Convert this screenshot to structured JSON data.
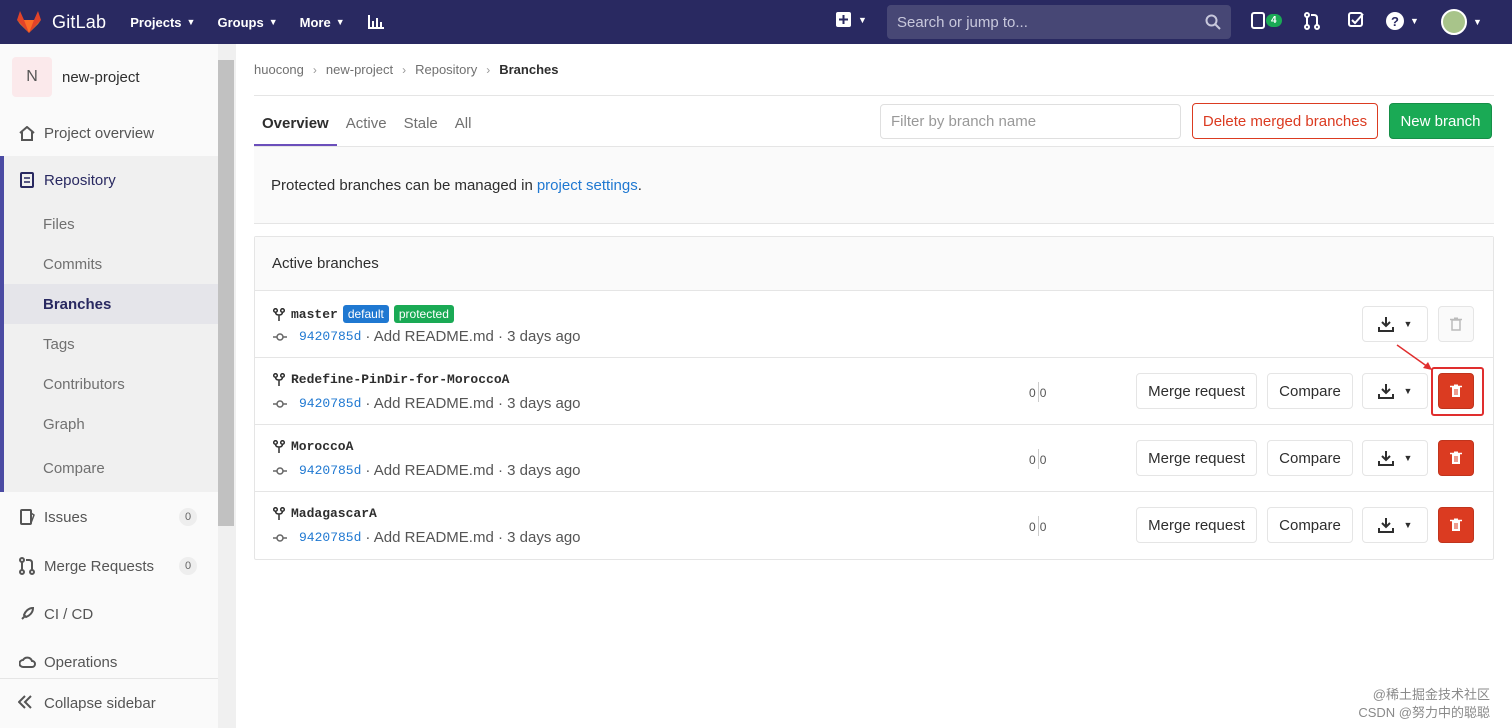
{
  "navbar": {
    "brand": "GitLab",
    "links": [
      {
        "label": "Projects"
      },
      {
        "label": "Groups"
      },
      {
        "label": "More"
      }
    ],
    "search_placeholder": "Search or jump to...",
    "todo_count": "4"
  },
  "sidebar": {
    "project_initial": "N",
    "project_name": "new-project",
    "items": {
      "overview": "Project overview",
      "repository": "Repository",
      "issues": "Issues",
      "issues_count": "0",
      "merge_requests": "Merge Requests",
      "merge_requests_count": "0",
      "cicd": "CI / CD",
      "operations": "Operations"
    },
    "repo_sub": [
      "Files",
      "Commits",
      "Branches",
      "Tags",
      "Contributors",
      "Graph",
      "Compare"
    ],
    "collapse": "Collapse sidebar"
  },
  "breadcrumb": [
    "huocong",
    "new-project",
    "Repository",
    "Branches"
  ],
  "tabs": [
    "Overview",
    "Active",
    "Stale",
    "All"
  ],
  "filter_placeholder": "Filter by branch name",
  "buttons": {
    "delete_merged": "Delete merged branches",
    "new_branch": "New branch",
    "merge_request": "Merge request",
    "compare": "Compare"
  },
  "info": {
    "text": "Protected branches can be managed in",
    "link": "project settings",
    "suffix": "."
  },
  "panel_title": "Active branches",
  "branches": [
    {
      "name": "master",
      "labels": [
        "default",
        "protected"
      ],
      "sha": "9420785d",
      "message": "· Add README.md · 3 days ago",
      "behind": "",
      "ahead": ""
    },
    {
      "name": "Redefine-PinDir-for-MoroccoA",
      "labels": [],
      "sha": "9420785d",
      "message": "· Add README.md · 3 days ago",
      "behind": "0",
      "ahead": "0"
    },
    {
      "name": "MoroccoA",
      "labels": [],
      "sha": "9420785d",
      "message": "· Add README.md · 3 days ago",
      "behind": "0",
      "ahead": "0"
    },
    {
      "name": "MadagascarA",
      "labels": [],
      "sha": "9420785d",
      "message": "· Add README.md · 3 days ago",
      "behind": "0",
      "ahead": "0"
    }
  ],
  "watermark": [
    "@稀土掘金技术社区",
    "CSDN @努力中的聪聪"
  ],
  "colors": {
    "navbar": "#292961",
    "green": "#1aaa55",
    "red": "#db3b21",
    "link": "#1f78d1"
  }
}
